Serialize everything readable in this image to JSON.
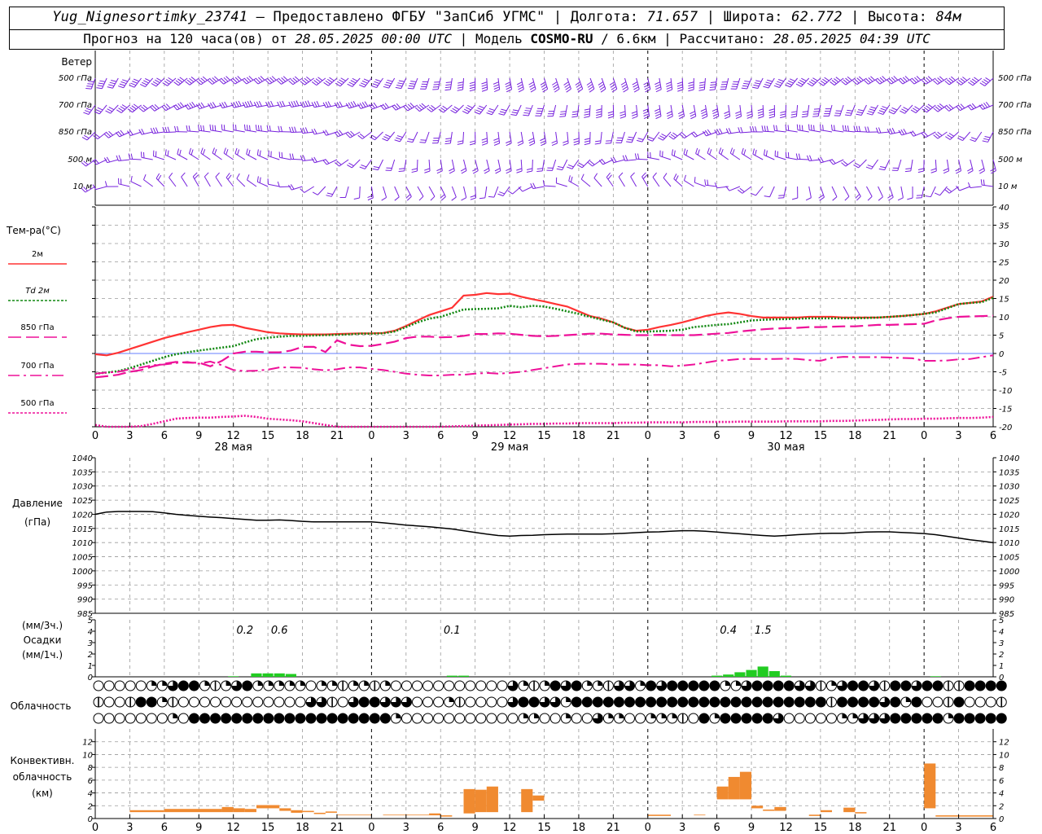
{
  "header": {
    "station": "Yug_Nignesortimky_23741",
    "dash": "—",
    "provider": "Предоставлено ФГБУ \"ЗапСиб УГМС\"",
    "lon_label": "Долгота:",
    "lon": "71.657",
    "lat_label": "Широта:",
    "lat": "62.772",
    "alt_label": "Высота:",
    "alt": "84м",
    "forecast_label": "Прогноз на 120 часа(ов) от",
    "forecast_start": "28.05.2025 00:00 UTC",
    "model_label": "Модель",
    "model": "COSMO-RU",
    "model_res": "/ 6.6км",
    "calc_label": "Рассчитано:",
    "calc_time": "28.05.2025 04:39 UTC"
  },
  "colors": {
    "t2m": "#ff3333",
    "td2m": "#118811",
    "t850": "#ee1199",
    "t700": "#ee1199",
    "t500": "#ee1199",
    "pressure": "#000000",
    "precip": "#22cc22",
    "convective": "#f08a30",
    "barb": "#7722dd",
    "zero_line": "#3355ff"
  },
  "chart_data": [
    {
      "type": "barbs",
      "title": "Ветер",
      "levels": [
        "500 гПа",
        "700 гПа",
        "850 гПа",
        "500 м",
        "10 м"
      ],
      "notes": "Wind barbs every hour at five levels; directions/speeds not labelled"
    },
    {
      "type": "line",
      "title": "Тем-ра(°С)",
      "ylim": [
        -20,
        40
      ],
      "yticks": [
        40,
        35,
        30,
        25,
        20,
        15,
        10,
        5,
        0,
        -5,
        -10,
        -15,
        -20
      ],
      "x_hours": [
        0,
        1,
        2,
        3,
        4,
        5,
        6,
        7,
        8,
        9,
        10,
        11,
        12,
        13,
        14,
        15,
        16,
        17,
        18,
        19,
        20,
        21,
        22,
        23,
        24,
        25,
        26,
        27,
        28,
        29,
        30,
        31,
        32,
        33,
        34,
        35,
        36,
        37,
        38,
        39,
        40,
        41,
        42,
        43,
        44,
        45,
        46,
        47,
        48,
        49,
        50,
        51,
        52,
        53,
        54,
        55,
        56,
        57,
        58,
        59,
        60,
        61,
        62,
        63,
        64,
        65,
        66,
        67,
        68,
        69,
        70,
        71,
        72,
        73,
        74,
        75,
        76,
        77,
        78
      ],
      "xtick_labels": [
        "0",
        "3",
        "6",
        "9",
        "12",
        "15",
        "18",
        "21",
        "0",
        "3",
        "6",
        "9",
        "12",
        "15",
        "18",
        "21",
        "0",
        "3",
        "6",
        "9",
        "12",
        "15",
        "18",
        "21",
        "0",
        "3",
        "6"
      ],
      "day_labels": [
        "28 мая",
        "29 мая",
        "30 мая"
      ],
      "series": [
        {
          "name": "2м",
          "key": "t2m",
          "style": "solid",
          "values": [
            -0.2,
            -0.5,
            0.2,
            1.2,
            2.2,
            3.2,
            4.2,
            5.0,
            5.8,
            6.5,
            7.2,
            7.7,
            7.8,
            7.0,
            6.4,
            5.8,
            5.5,
            5.3,
            5.2,
            5.2,
            5.2,
            5.3,
            5.4,
            5.5,
            5.5,
            5.6,
            6.2,
            7.5,
            9.0,
            10.5,
            11.5,
            12.5,
            15.8,
            16.0,
            16.5,
            16.2,
            16.3,
            15.5,
            14.8,
            14.2,
            13.5,
            12.8,
            11.5,
            10.2,
            9.5,
            8.5,
            7.0,
            6.2,
            6.5,
            7.2,
            7.8,
            8.5,
            9.3,
            10.2,
            10.8,
            11.2,
            10.8,
            10.2,
            9.8,
            9.8,
            9.8,
            9.8,
            10.0,
            10.0,
            10.0,
            9.8,
            9.8,
            9.8,
            9.8,
            10.0,
            10.2,
            10.5,
            10.8,
            11.5,
            12.5,
            13.5,
            13.8,
            14.2,
            15.5
          ]
        },
        {
          "name": "Td 2м",
          "key": "td2m",
          "style": "dotted",
          "values": [
            -5.5,
            -5.2,
            -4.8,
            -4.0,
            -3.0,
            -2.0,
            -1.0,
            -0.2,
            0.3,
            0.8,
            1.2,
            1.6,
            2.0,
            3.0,
            3.9,
            4.3,
            4.6,
            4.8,
            4.8,
            4.9,
            5.0,
            5.1,
            5.2,
            5.4,
            5.4,
            5.5,
            6.0,
            7.2,
            8.5,
            9.5,
            10.0,
            11.0,
            12.0,
            12.1,
            12.2,
            12.3,
            13.0,
            12.6,
            13.0,
            12.8,
            12.2,
            11.5,
            10.8,
            10.0,
            9.2,
            8.5,
            7.0,
            6.0,
            6.0,
            6.1,
            6.2,
            6.5,
            7.2,
            7.5,
            7.8,
            8.0,
            8.5,
            9.0,
            9.2,
            9.3,
            9.4,
            9.5,
            9.6,
            9.6,
            9.6,
            9.6,
            9.6,
            9.7,
            9.8,
            10.0,
            10.2,
            10.5,
            10.8,
            11.2,
            12.3,
            13.5,
            13.8,
            14.0,
            15.2
          ]
        },
        {
          "name": "850 гПа",
          "key": "t850",
          "style": "longdash",
          "values": [
            -6.5,
            -6.2,
            -5.8,
            -5.0,
            -4.5,
            -3.5,
            -2.8,
            -2.3,
            -2.5,
            -2.5,
            -3.5,
            -2.0,
            0.0,
            0.5,
            0.5,
            0.3,
            0.3,
            0.8,
            1.8,
            1.8,
            0.4,
            3.6,
            2.4,
            2.0,
            2.1,
            2.6,
            3.2,
            4.2,
            4.6,
            4.6,
            4.4,
            4.5,
            4.8,
            5.3,
            5.3,
            5.5,
            5.4,
            5.1,
            4.8,
            4.7,
            4.8,
            5.0,
            5.2,
            5.4,
            5.4,
            5.2,
            5.1,
            5.0,
            5.0,
            5.1,
            5.0,
            5.0,
            5.0,
            5.2,
            5.4,
            5.6,
            6.0,
            6.3,
            6.6,
            6.8,
            6.9,
            7.0,
            7.2,
            7.2,
            7.3,
            7.4,
            7.4,
            7.6,
            7.8,
            7.8,
            7.9,
            8.0,
            8.1,
            9.0,
            9.6,
            10.0,
            10.1,
            10.2,
            10.3
          ]
        },
        {
          "name": "700 гПа",
          "key": "t700",
          "style": "dashdot",
          "values": [
            -5.5,
            -5.2,
            -5.0,
            -4.3,
            -3.8,
            -3.2,
            -3.0,
            -2.6,
            -2.3,
            -2.8,
            -2.2,
            -3.2,
            -4.5,
            -4.8,
            -4.7,
            -4.4,
            -3.8,
            -3.8,
            -3.9,
            -4.3,
            -4.6,
            -4.3,
            -3.8,
            -3.8,
            -4.2,
            -4.5,
            -5.0,
            -5.5,
            -5.8,
            -6.0,
            -6.0,
            -5.8,
            -5.8,
            -5.5,
            -5.3,
            -5.5,
            -5.3,
            -5.0,
            -4.5,
            -4.0,
            -3.5,
            -3.0,
            -2.8,
            -2.8,
            -2.8,
            -3.0,
            -3.0,
            -3.0,
            -3.2,
            -3.2,
            -3.5,
            -3.3,
            -3.0,
            -2.5,
            -2.0,
            -1.8,
            -1.5,
            -1.5,
            -1.5,
            -1.5,
            -1.4,
            -1.5,
            -1.8,
            -2.0,
            -1.2,
            -0.9,
            -1.0,
            -1.0,
            -1.0,
            -1.1,
            -1.2,
            -1.3,
            -2.0,
            -2.0,
            -1.9,
            -1.6,
            -1.5,
            -1.0,
            -0.5
          ]
        },
        {
          "name": "500 гПа",
          "key": "t500",
          "style": "dotted",
          "values": [
            -19.5,
            -20.5,
            -20.8,
            -20.5,
            -19.8,
            -19.2,
            -18.5,
            -17.8,
            -17.6,
            -17.5,
            -17.5,
            -17.3,
            -17.2,
            -17.0,
            -17.3,
            -17.8,
            -18.0,
            -18.2,
            -18.5,
            -19.0,
            -19.5,
            -20.0,
            -20.3,
            -20.6,
            -20.8,
            -20.8,
            -20.8,
            -20.6,
            -20.4,
            -20.2,
            -20.0,
            -19.9,
            -19.8,
            -19.7,
            -19.6,
            -19.5,
            -19.4,
            -19.3,
            -19.2,
            -19.2,
            -19.1,
            -19.1,
            -19.0,
            -19.0,
            -19.0,
            -19.0,
            -18.9,
            -18.9,
            -18.8,
            -18.8,
            -18.8,
            -18.8,
            -18.7,
            -18.7,
            -18.7,
            -18.7,
            -18.6,
            -18.6,
            -18.6,
            -18.6,
            -18.5,
            -18.5,
            -18.5,
            -18.5,
            -18.4,
            -18.4,
            -18.3,
            -18.2,
            -18.1,
            -18.0,
            -17.9,
            -17.9,
            -17.8,
            -17.8,
            -17.7,
            -17.6,
            -17.6,
            -17.5,
            -17.3
          ]
        }
      ]
    },
    {
      "type": "line",
      "title": "Давление",
      "ylabel": "(гПа)",
      "ylim": [
        985,
        1040
      ],
      "yticks": [
        1040,
        1035,
        1030,
        1025,
        1020,
        1015,
        1010,
        1005,
        1000,
        995,
        990,
        985
      ],
      "series": [
        {
          "name": "Давление",
          "key": "pressure",
          "values": [
            1020.0,
            1020.8,
            1021.0,
            1021.0,
            1021.0,
            1020.9,
            1020.5,
            1020.0,
            1019.6,
            1019.3,
            1019.0,
            1018.8,
            1018.5,
            1018.2,
            1017.9,
            1017.9,
            1018.0,
            1017.8,
            1017.5,
            1017.3,
            1017.3,
            1017.3,
            1017.3,
            1017.3,
            1017.3,
            1017.0,
            1016.6,
            1016.2,
            1015.9,
            1015.6,
            1015.2,
            1014.8,
            1014.2,
            1013.6,
            1013.0,
            1012.5,
            1012.3,
            1012.5,
            1012.6,
            1012.8,
            1012.9,
            1013.0,
            1013.0,
            1013.0,
            1013.0,
            1013.1,
            1013.3,
            1013.5,
            1013.7,
            1013.8,
            1014.0,
            1014.2,
            1014.2,
            1014.0,
            1013.7,
            1013.4,
            1013.1,
            1012.8,
            1012.5,
            1012.3,
            1012.5,
            1012.8,
            1013.0,
            1013.2,
            1013.3,
            1013.3,
            1013.5,
            1013.7,
            1013.8,
            1013.8,
            1013.6,
            1013.4,
            1013.2,
            1012.8,
            1012.2,
            1011.6,
            1011.0,
            1010.5,
            1010.0
          ]
        }
      ]
    },
    {
      "type": "bar",
      "title": "Осадки",
      "ylabel_top": "(мм/3ч.)",
      "ylabel_bottom": "(мм/1ч.)",
      "ylim": [
        0,
        5
      ],
      "yticks": [
        5,
        4,
        3,
        2,
        1,
        0
      ],
      "totals_3h": [
        {
          "hour": 13,
          "label": "0.2"
        },
        {
          "hour": 16,
          "label": "0.6"
        },
        {
          "hour": 31,
          "label": "0.1"
        },
        {
          "hour": 55,
          "label": "0.4"
        },
        {
          "hour": 58,
          "label": "1.5"
        }
      ],
      "hourly": [
        {
          "hour": 12,
          "value": 0.05
        },
        {
          "hour": 14,
          "value": 0.3
        },
        {
          "hour": 15,
          "value": 0.3
        },
        {
          "hour": 16,
          "value": 0.3
        },
        {
          "hour": 17,
          "value": 0.25
        },
        {
          "hour": 31,
          "value": 0.1
        },
        {
          "hour": 32,
          "value": 0.1
        },
        {
          "hour": 54,
          "value": 0.1
        },
        {
          "hour": 55,
          "value": 0.2
        },
        {
          "hour": 56,
          "value": 0.4
        },
        {
          "hour": 57,
          "value": 0.6
        },
        {
          "hour": 58,
          "value": 0.9
        },
        {
          "hour": 59,
          "value": 0.5
        },
        {
          "hour": 60,
          "value": 0.1
        },
        {
          "hour": 73,
          "value": 0.05
        }
      ]
    },
    {
      "type": "cloud_symbols",
      "title": "Облачность",
      "rows": [
        "00000223442123422222022122120000000000032124342213324344444223444433123443144344114444",
        "10014421000000000000331034433300021000034433244444444444444444444444414444342400140001",
        "00000002044444444444444444442000000000002200200322002221042444443000002233344444244444"
      ]
    },
    {
      "type": "bar",
      "title": "Конвективн.",
      "ylabel": "облачность",
      "unit": "(км)",
      "ylim": [
        0,
        14
      ],
      "yticks": [
        12,
        10,
        8,
        6,
        4,
        2,
        0
      ],
      "layers": [
        {
          "from_hour": 3,
          "to_hour": 6,
          "base": 1.0,
          "top": 1.3
        },
        {
          "from_hour": 6,
          "to_hour": 11,
          "base": 1.0,
          "top": 1.5
        },
        {
          "from_hour": 11,
          "to_hour": 12,
          "base": 1.0,
          "top": 1.8
        },
        {
          "from_hour": 12,
          "to_hour": 13,
          "base": 1.0,
          "top": 1.6
        },
        {
          "from_hour": 13,
          "to_hour": 14,
          "base": 1.0,
          "top": 1.5
        },
        {
          "from_hour": 14,
          "to_hour": 16,
          "base": 1.6,
          "top": 2.1
        },
        {
          "from_hour": 16,
          "to_hour": 17,
          "base": 1.2,
          "top": 1.6
        },
        {
          "from_hour": 17,
          "to_hour": 18,
          "base": 0.9,
          "top": 1.3
        },
        {
          "from_hour": 18,
          "to_hour": 19,
          "base": 1.0,
          "top": 1.2
        },
        {
          "from_hour": 19,
          "to_hour": 20,
          "base": 0.7,
          "top": 0.9
        },
        {
          "from_hour": 20,
          "to_hour": 21,
          "base": 0.9,
          "top": 1.1
        },
        {
          "from_hour": 21,
          "to_hour": 24,
          "base": 0.5,
          "top": 0.6
        },
        {
          "from_hour": 25,
          "to_hour": 29,
          "base": 0.5,
          "top": 0.6
        },
        {
          "from_hour": 29,
          "to_hour": 30,
          "base": 0.5,
          "top": 0.8
        },
        {
          "from_hour": 30,
          "to_hour": 31,
          "base": 0.3,
          "top": 0.5
        },
        {
          "from_hour": 32,
          "to_hour": 33,
          "base": 0.8,
          "top": 4.6
        },
        {
          "from_hour": 33,
          "to_hour": 34,
          "base": 1.0,
          "top": 4.5
        },
        {
          "from_hour": 34,
          "to_hour": 35,
          "base": 1.0,
          "top": 5.0
        },
        {
          "from_hour": 37,
          "to_hour": 38,
          "base": 1.0,
          "top": 4.6
        },
        {
          "from_hour": 38,
          "to_hour": 39,
          "base": 2.8,
          "top": 3.6
        },
        {
          "from_hour": 48,
          "to_hour": 50,
          "base": 0.4,
          "top": 0.6
        },
        {
          "from_hour": 52,
          "to_hour": 53,
          "base": 0.5,
          "top": 0.6
        },
        {
          "from_hour": 54,
          "to_hour": 55,
          "base": 3.0,
          "top": 5.0
        },
        {
          "from_hour": 55,
          "to_hour": 56,
          "base": 3.0,
          "top": 6.5
        },
        {
          "from_hour": 56,
          "to_hour": 57,
          "base": 3.0,
          "top": 7.3
        },
        {
          "from_hour": 57,
          "to_hour": 58,
          "base": 1.6,
          "top": 2.0
        },
        {
          "from_hour": 58,
          "to_hour": 59,
          "base": 1.2,
          "top": 1.4
        },
        {
          "from_hour": 59,
          "to_hour": 60,
          "base": 1.2,
          "top": 1.8
        },
        {
          "from_hour": 62,
          "to_hour": 63,
          "base": 0.4,
          "top": 0.6
        },
        {
          "from_hour": 63,
          "to_hour": 64,
          "base": 1.0,
          "top": 1.3
        },
        {
          "from_hour": 65,
          "to_hour": 66,
          "base": 1.0,
          "top": 1.7
        },
        {
          "from_hour": 66,
          "to_hour": 67,
          "base": 0.8,
          "top": 1.0
        },
        {
          "from_hour": 72,
          "to_hour": 73,
          "base": 1.6,
          "top": 8.6
        },
        {
          "from_hour": 73,
          "to_hour": 78,
          "base": 0.3,
          "top": 0.5
        }
      ]
    }
  ]
}
